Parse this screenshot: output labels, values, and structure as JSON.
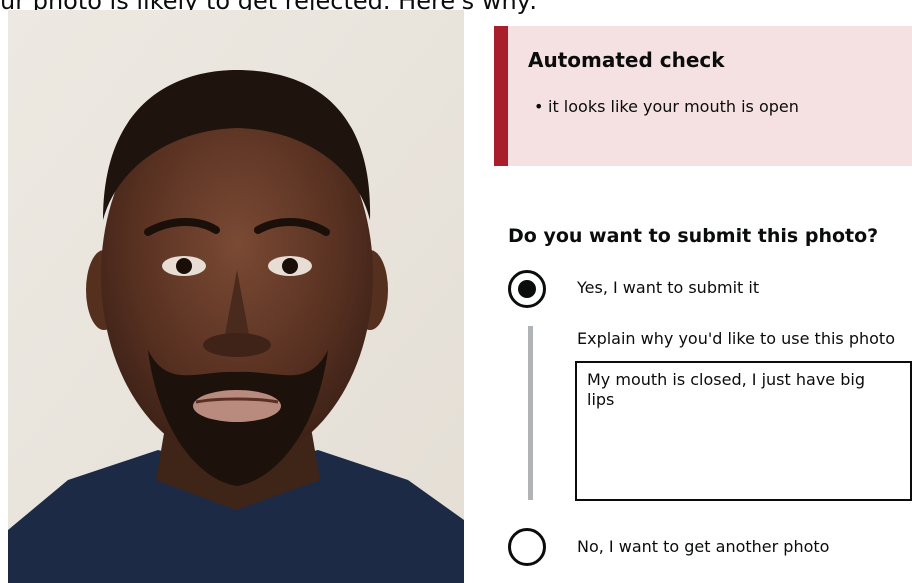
{
  "page": {
    "cropped_heading": "ur photo is likely to get rejected. Here's why:"
  },
  "warning": {
    "title": "Automated check",
    "items": [
      "it looks like your mouth is open"
    ]
  },
  "question": {
    "title": "Do you want to submit this photo?",
    "options": [
      {
        "label": "Yes, I want to submit it",
        "selected": true
      },
      {
        "label": "No, I want to get another photo",
        "selected": false
      }
    ],
    "conditional": {
      "label": "Explain why you'd like to use this photo",
      "value": "My mouth is closed, I just have big\nlips"
    }
  },
  "colors": {
    "warning_border": "#a81e2a",
    "warning_background": "#f6e1e2",
    "text": "#0b0c0c",
    "conditional_bar": "#b1b4b6"
  },
  "icons": {
    "photo": "passport-photo-portrait",
    "radio_selected": "radio-selected-icon",
    "radio_unselected": "radio-unselected-icon"
  }
}
